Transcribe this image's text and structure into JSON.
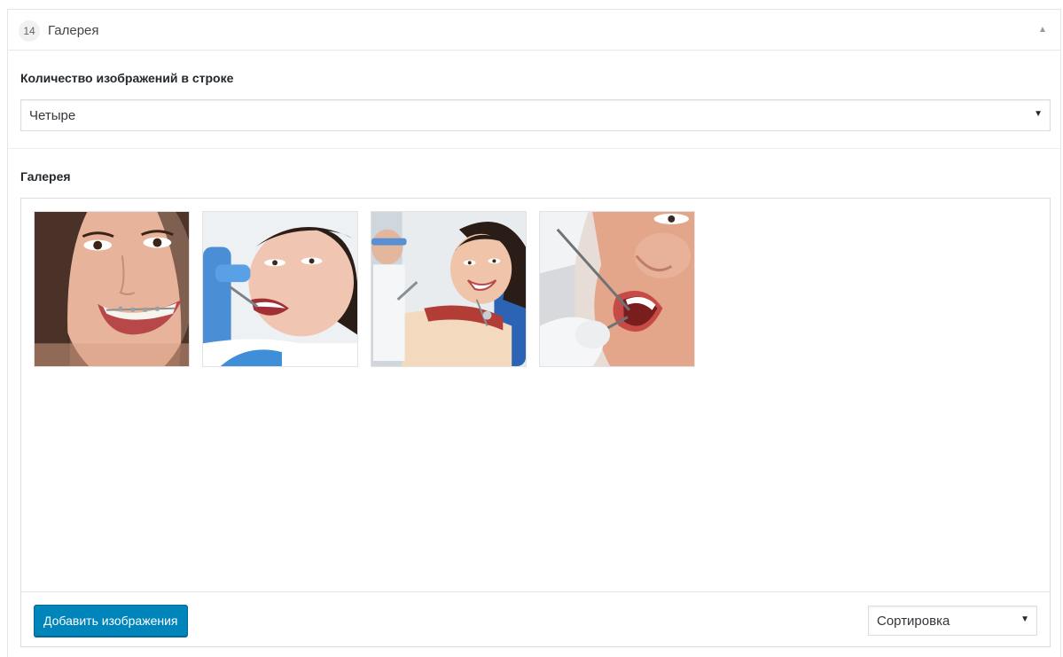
{
  "layout": {
    "order": "14",
    "title": "Галерея",
    "collapse_icon": "triangle-up-icon"
  },
  "fields": {
    "images_per_row": {
      "label": "Количество изображений в строке",
      "selected": "Четыре"
    },
    "gallery": {
      "label": "Галерея",
      "images": [
        {
          "name": "braces-smile-photo"
        },
        {
          "name": "dental-exam-photo"
        },
        {
          "name": "dentist-chair-smile-photo"
        },
        {
          "name": "mouth-closeup-photo"
        }
      ],
      "add_button": "Добавить изображения",
      "sort_selected": "Сортировка"
    }
  },
  "colors": {
    "primary_button": "#0085ba",
    "border": "#dddddd"
  }
}
